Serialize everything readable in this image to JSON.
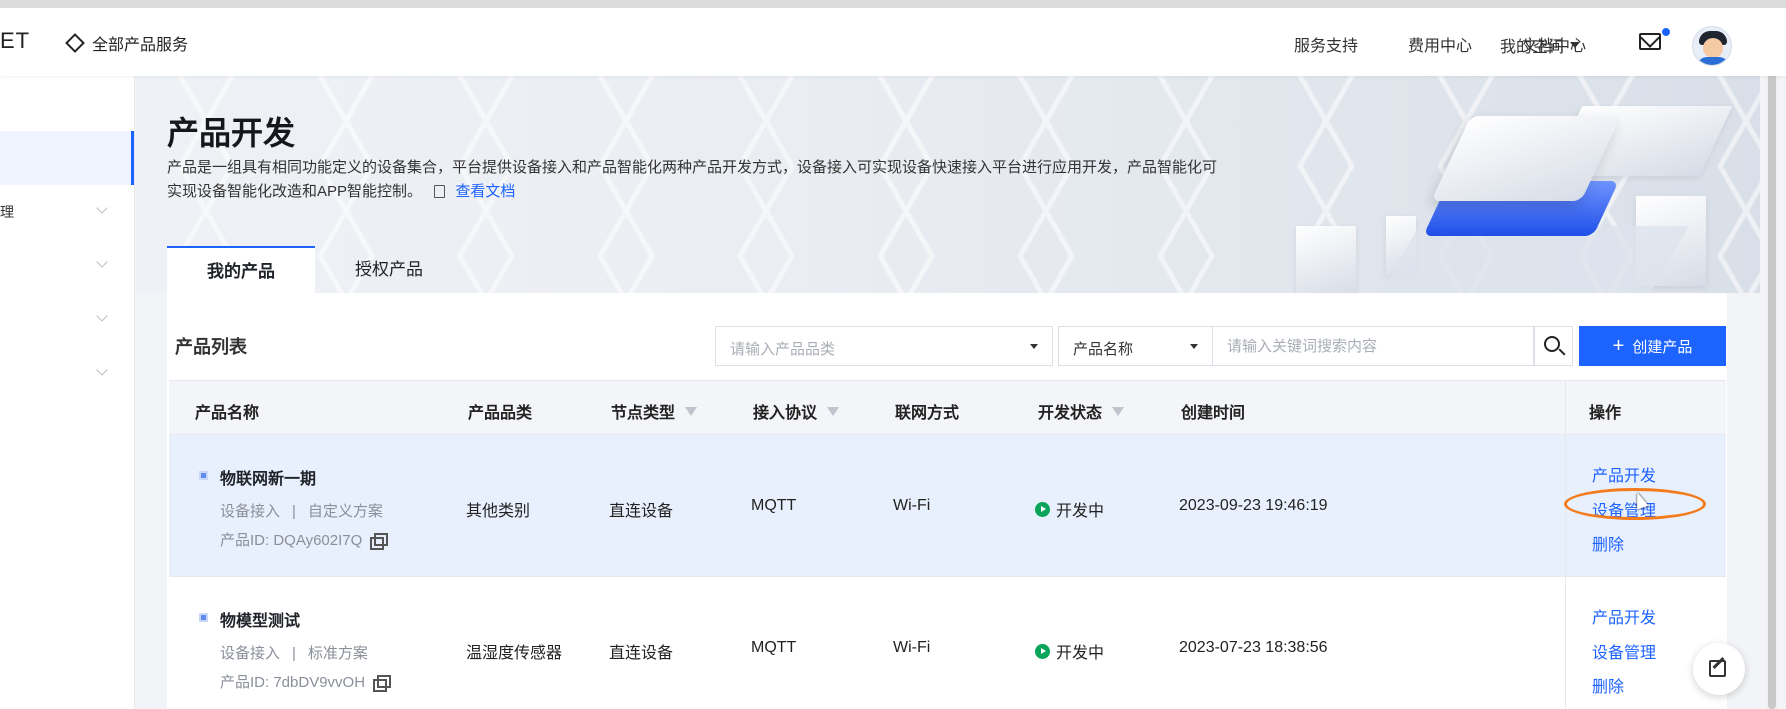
{
  "header": {
    "brand": "ET",
    "all_products": "全部产品服务",
    "nav": [
      "服务支持",
      "费用中心",
      "文档中心"
    ],
    "my_space": "我的空间"
  },
  "sidebar": {
    "items": [
      {
        "label": "",
        "active": true
      },
      {
        "label": "理"
      },
      {
        "label": ""
      },
      {
        "label": ""
      },
      {
        "label": ""
      }
    ]
  },
  "banner": {
    "title": "产品开发",
    "description": "产品是一组具有相同功能定义的设备集合，平台提供设备接入和产品智能化两种产品开发方式，设备接入可实现设备快速接入平台进行应用开发，产品智能化可实现设备智能化改造和APP智能控制。",
    "doc_link": "查看文档"
  },
  "tabs": [
    {
      "label": "我的产品",
      "active": true
    },
    {
      "label": "授权产品",
      "active": false
    }
  ],
  "toolbar": {
    "list_title": "产品列表",
    "category_placeholder": "请输入产品品类",
    "search_field": "产品名称",
    "search_placeholder": "请输入关键词搜索内容",
    "create_label": "创建产品"
  },
  "table": {
    "columns": [
      "产品名称",
      "产品品类",
      "节点类型",
      "接入协议",
      "联网方式",
      "开发状态",
      "创建时间",
      "操作"
    ],
    "rows": [
      {
        "name": "物联网新一期",
        "access": "设备接入",
        "scheme": "自定义方案",
        "product_id": "产品ID:  DQAy602I7Q",
        "category": "其他类别",
        "node_type": "直连设备",
        "protocol": "MQTT",
        "network": "Wi-Fi",
        "status": "开发中",
        "created": "2023-09-23 19:46:19",
        "ops": [
          "产品开发",
          "设备管理",
          "删除"
        ]
      },
      {
        "name": "物模型测试",
        "access": "设备接入",
        "scheme": "标准方案",
        "product_id": "产品ID:  7dbDV9vvOH",
        "category": "温湿度传感器",
        "node_type": "直连设备",
        "protocol": "MQTT",
        "network": "Wi-Fi",
        "status": "开发中",
        "created": "2023-07-23 18:38:56",
        "ops": [
          "产品开发",
          "设备管理",
          "删除"
        ]
      }
    ]
  },
  "colors": {
    "accent": "#1d63ff",
    "status_green": "#0aa55b",
    "highlight_row": "#e9f0fd",
    "annotation_orange": "#f37b1c"
  },
  "icons": [
    "diamond-icon",
    "mail-icon",
    "avatar",
    "doc-icon",
    "search-icon",
    "plus-icon",
    "filter-icon",
    "copy-icon",
    "status-play-icon",
    "feedback-icon"
  ]
}
